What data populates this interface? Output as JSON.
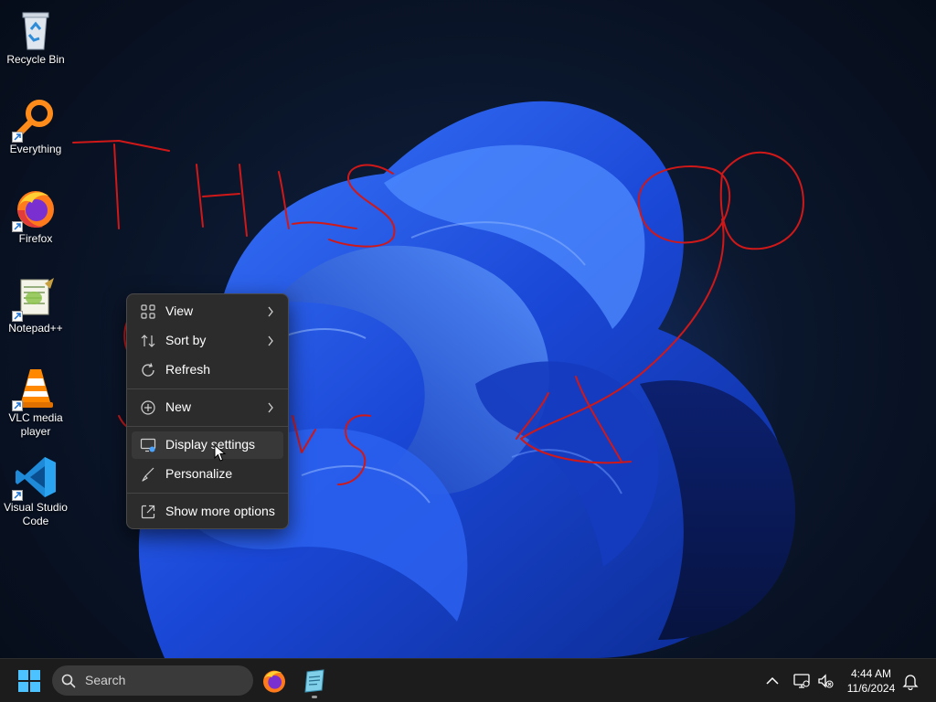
{
  "desktop_icons": [
    {
      "label": "Recycle Bin",
      "icon": "recycle-bin-icon"
    },
    {
      "label": "Everything",
      "icon": "everything-search-icon"
    },
    {
      "label": "Firefox",
      "icon": "firefox-icon"
    },
    {
      "label": "Notepad++",
      "icon": "notepad-plus-plus-icon"
    },
    {
      "label": "VLC media player",
      "icon": "vlc-cone-icon"
    },
    {
      "label": "Visual Studio Code",
      "icon": "vscode-icon"
    }
  ],
  "context_menu": {
    "items": [
      {
        "label": "View",
        "icon": "grid-view-icon",
        "submenu": true
      },
      {
        "label": "Sort by",
        "icon": "sort-arrows-icon",
        "submenu": true
      },
      {
        "label": "Refresh",
        "icon": "refresh-icon",
        "submenu": false
      },
      {
        "label": "New",
        "icon": "plus-circle-icon",
        "submenu": true
      },
      {
        "label": "Display settings",
        "icon": "display-settings-icon",
        "submenu": false,
        "hovered": true
      },
      {
        "label": "Personalize",
        "icon": "brush-icon",
        "submenu": false
      },
      {
        "label": "Show more options",
        "icon": "external-options-icon",
        "submenu": false
      }
    ]
  },
  "taskbar": {
    "search_placeholder": "Search",
    "pinned_apps": [
      "firefox-icon",
      "notepad-icon"
    ],
    "tray_icons": [
      "chevron-up-icon",
      "network-icon",
      "volume-muted-icon"
    ],
    "clock": {
      "time": "4:44 AM",
      "date": "11/6/2024"
    },
    "notification_icon": "bell-icon"
  },
  "colors": {
    "desktop_bg": "#0a1529",
    "bloom_blue": "#1e4fe0",
    "scribble": "#d01818",
    "menu_bg": "#2c2c2c",
    "taskbar_bg": "#1c1c1c"
  }
}
